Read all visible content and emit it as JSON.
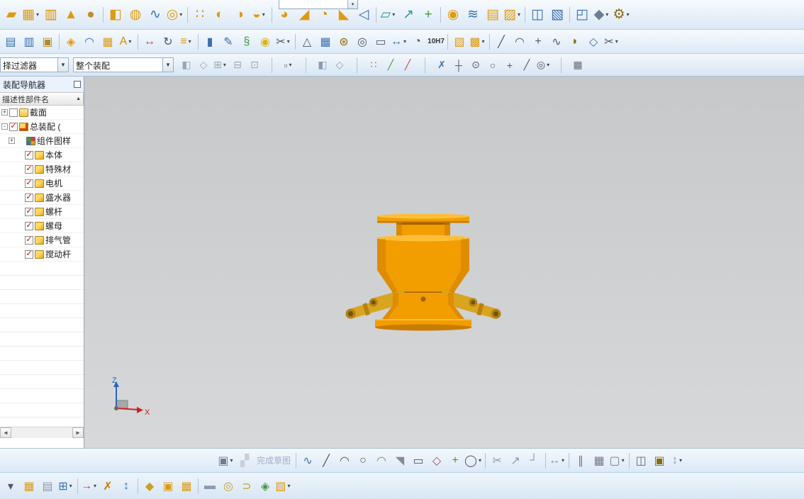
{
  "colors": {
    "model_main": "#f29d00",
    "model_light": "#ffbe3a",
    "model_dark": "#c97c00",
    "model_darker": "#a06200",
    "pipe": "#d9a41f",
    "pipe_dark": "#b5830f",
    "pipe_darkest": "#6e530a",
    "axis_x": "#cc2222",
    "axis_z": "#2b62c4",
    "viewport_top": "#c6c8ca",
    "viewport_bottom": "#d6d8da",
    "check_red": "#cc0000"
  },
  "filter_bar": {
    "selection_filter": "择过滤器",
    "scope": "整个装配"
  },
  "navigator": {
    "title": "装配导航器",
    "column_header": "描述性部件名",
    "sort_indicator": "▲",
    "rows": [
      {
        "exp": "+",
        "chk": "off",
        "ic": "node-icon ic-folder",
        "label": "截面",
        "pad": "padding-left:2px"
      },
      {
        "exp": "-",
        "chk": "on",
        "ic": "node-icon ic-assembly",
        "label": "总装配 (",
        "pad": "padding-left:2px"
      },
      {
        "exp": "+",
        "chk": "none",
        "ic": "node-icon ic-pattern",
        "label": "组件图样",
        "pad": "padding-left:12px"
      },
      {
        "exp": "",
        "chk": "on",
        "ic": "node-icon ic-part",
        "label": "本体",
        "pad": "padding-left:24px"
      },
      {
        "exp": "",
        "chk": "on",
        "ic": "node-icon ic-part",
        "label": "特殊材",
        "pad": "padding-left:24px"
      },
      {
        "exp": "",
        "chk": "on",
        "ic": "node-icon ic-part",
        "label": "电机",
        "pad": "padding-left:24px"
      },
      {
        "exp": "",
        "chk": "on",
        "ic": "node-icon ic-part",
        "label": "盛水器",
        "pad": "padding-left:24px"
      },
      {
        "exp": "",
        "chk": "on",
        "ic": "node-icon ic-part",
        "label": "螺杆",
        "pad": "padding-left:24px"
      },
      {
        "exp": "",
        "chk": "on",
        "ic": "node-icon ic-part",
        "label": "螺母",
        "pad": "padding-left:24px"
      },
      {
        "exp": "",
        "chk": "on",
        "ic": "node-icon ic-part",
        "label": "排气管",
        "pad": "padding-left:24px"
      },
      {
        "exp": "",
        "chk": "on",
        "ic": "node-icon ic-part",
        "label": "搅动杆",
        "pad": "padding-left:24px"
      }
    ],
    "empty_rows": [
      {},
      {},
      {},
      {},
      {},
      {},
      {},
      {},
      {},
      {},
      {}
    ],
    "scroll": {
      "left": "◄",
      "right": "►"
    }
  },
  "viewport": {
    "axis_x": "X",
    "axis_z": "Z"
  },
  "toolbars": {
    "row1": [
      {
        "n": "new-part-icon",
        "g": "▰",
        "style": "color:#e09a10"
      },
      {
        "n": "block-icon",
        "g": "▦",
        "style": "color:#e09a10",
        "t": "dd"
      },
      {
        "n": "cylinder-icon",
        "g": "▥",
        "style": "color:#d88f00"
      },
      {
        "n": "cone-icon",
        "g": "▲",
        "style": "color:#e09a10"
      },
      {
        "n": "sphere-icon",
        "g": "●",
        "style": "color:#c98a2a"
      },
      {
        "t": "sep",
        "ia": "false"
      },
      {
        "n": "extrude-icon",
        "g": "◧",
        "style": "color:#e09a10"
      },
      {
        "n": "revolve-icon",
        "g": "◍",
        "style": "color:#e09a10"
      },
      {
        "n": "sweep-icon",
        "g": "∿",
        "style": "color:#3a6fb0"
      },
      {
        "n": "tube-icon",
        "g": "◎",
        "style": "color:#e09a10",
        "t": "dd"
      },
      {
        "t": "sep",
        "ia": "false"
      },
      {
        "n": "pattern-feature-icon",
        "g": "∷",
        "style": "color:#d88f00"
      },
      {
        "n": "unite-icon",
        "g": "◐",
        "style": "color:#e09a10"
      },
      {
        "n": "subtract-icon",
        "g": "◑",
        "style": "color:#e09a10"
      },
      {
        "n": "intersect-icon",
        "g": "◒",
        "style": "color:#e09a10",
        "t": "dd"
      },
      {
        "t": "sep",
        "ia": "false"
      },
      {
        "n": "edge-blend-icon",
        "g": "◕",
        "style": "color:#e09a10"
      },
      {
        "n": "chamfer-icon",
        "g": "◢",
        "style": "color:#e09a10"
      },
      {
        "n": "shell-icon",
        "g": "◔",
        "style": "color:#d88f00"
      },
      {
        "n": "draft-icon",
        "g": "◣",
        "style": "color:#e09a10"
      },
      {
        "n": "trim-body-icon",
        "g": "◁",
        "style": "color:#3a6fb0"
      },
      {
        "t": "sep",
        "ia": "false"
      },
      {
        "n": "datum-plane-icon",
        "g": "▱",
        "style": "color:#2e9b9b",
        "t": "dd"
      },
      {
        "n": "datum-axis-icon",
        "g": "↗",
        "style": "color:#2e9b9b"
      },
      {
        "n": "datum-csys-icon",
        "g": "+",
        "style": "color:#3f9b3f"
      },
      {
        "t": "sep",
        "ia": "false"
      },
      {
        "n": "hole-icon",
        "g": "◉",
        "style": "color:#e09a10"
      },
      {
        "n": "thread-icon",
        "g": "≋",
        "style": "color:#3a6fb0"
      },
      {
        "n": "rib-icon",
        "g": "▤",
        "style": "color:#e09a10"
      },
      {
        "n": "emboss-icon",
        "g": "▨",
        "style": "color:#e09a10",
        "t": "dd"
      },
      {
        "t": "sep",
        "ia": "false"
      },
      {
        "n": "mirror-feature-icon",
        "g": "◫",
        "style": "color:#3a6fb0"
      },
      {
        "n": "sheet-body-icon",
        "g": "▧",
        "style": "color:#3a6fb0"
      },
      {
        "t": "sep",
        "ia": "false"
      },
      {
        "n": "section-view-icon",
        "g": "◰",
        "style": "color:#3a6fb0"
      },
      {
        "n": "render-style-icon",
        "g": "◆",
        "style": "color:#6b7f93",
        "t": "dd"
      },
      {
        "n": "customize-icon",
        "g": "⚙",
        "style": "color:#8a6a10",
        "t": "dd"
      }
    ],
    "row2": [
      {
        "n": "layer-settings-icon",
        "g": "▤",
        "style": "color:#3a6fb0"
      },
      {
        "n": "layer-category-icon",
        "g": "▥",
        "style": "color:#3a6fb0"
      },
      {
        "n": "clipboard-icon",
        "g": "▣",
        "style": "color:#b58a2a"
      },
      {
        "t": "sep",
        "ia": "false"
      },
      {
        "n": "transform-icon",
        "g": "◈",
        "style": "color:#e09a10"
      },
      {
        "n": "wave-link-icon",
        "g": "◠",
        "style": "color:#3a6fb0"
      },
      {
        "n": "pattern-geometry-icon",
        "g": "▦",
        "style": "color:#e09a10"
      },
      {
        "n": "text-tool-icon",
        "g": "A",
        "style": "color:#d88f00",
        "t": "dd"
      },
      {
        "t": "sep",
        "ia": "false"
      },
      {
        "n": "move-object-icon",
        "g": "↔",
        "style": "color:#b04a4a"
      },
      {
        "n": "rotate-object-icon",
        "g": "↻",
        "style": "color:#556"
      },
      {
        "n": "align-icon",
        "g": "≡",
        "style": "color:#e09a10",
        "t": "dd"
      },
      {
        "t": "sep",
        "ia": "false"
      },
      {
        "n": "expression-icon",
        "g": "▮",
        "style": "color:#3a6fb0"
      },
      {
        "n": "annotate-icon",
        "g": "✎",
        "style": "color:#3a6fb0"
      },
      {
        "n": "spring-tool-icon",
        "g": "§",
        "style": "color:#3f9b3f"
      },
      {
        "n": "washer-icon",
        "g": "◉",
        "style": "color:#d9b419"
      },
      {
        "n": "trim-curve-icon",
        "g": "✂",
        "style": "color:#556",
        "t": "dd"
      },
      {
        "t": "sep",
        "ia": "false"
      },
      {
        "n": "triangle-mesh-icon",
        "g": "△",
        "style": "color:#556"
      },
      {
        "n": "sheet-grid-icon",
        "g": "▦",
        "style": "color:#3a6fb0"
      },
      {
        "n": "gear-pair-icon",
        "g": "⊛",
        "style": "color:#8a6a10"
      },
      {
        "n": "bearing-icon",
        "g": "◎",
        "style": "color:#556"
      },
      {
        "n": "note-icon",
        "g": "▭",
        "style": "color:#556"
      },
      {
        "n": "dimension-icon",
        "g": "↔",
        "style": "color:#3a6fb0",
        "t": "dd"
      },
      {
        "n": "binocular-icon",
        "g": "◔",
        "style": "color:#556"
      },
      {
        "n": "tolerance-label",
        "g": "10H7",
        "t": "text",
        "style": "color:#333"
      },
      {
        "t": "sep",
        "ia": "false"
      },
      {
        "n": "arrangement-icon",
        "g": "▧",
        "style": "color:#e09a10"
      },
      {
        "n": "exploded-view-icon",
        "g": "▩",
        "style": "color:#e09a10",
        "t": "dd"
      },
      {
        "t": "sep",
        "ia": "false"
      },
      {
        "n": "line-curve-icon",
        "g": "╱",
        "style": "color:#556"
      },
      {
        "n": "arc-curve-icon",
        "g": "◠",
        "style": "color:#556"
      },
      {
        "n": "point-tool-icon",
        "g": "+",
        "style": "color:#556"
      },
      {
        "n": "studio-spline-icon",
        "g": "∿",
        "style": "color:#556"
      },
      {
        "n": "surface-icon",
        "g": "◗",
        "style": "color:#8a6a10"
      },
      {
        "n": "sew-icon",
        "g": "◇",
        "style": "color:#3a6fb0"
      },
      {
        "n": "section-curve-icon",
        "g": "✂",
        "style": "color:#556",
        "t": "dd"
      }
    ],
    "row3": [
      {
        "n": "show-hide-icon",
        "g": "◧",
        "style": "color:#9aa7b5"
      },
      {
        "n": "immediate-hide-icon",
        "g": "◇",
        "style": "color:#9aa7b5"
      },
      {
        "n": "move-to-layer-icon",
        "g": "⊞",
        "style": "color:#9aa7b5",
        "t": "dd"
      },
      {
        "n": "copy-to-layer-icon",
        "g": "⊟",
        "style": "color:#9aa7b5"
      },
      {
        "n": "layer-in-view-icon",
        "g": "⊡",
        "style": "color:#9aa7b5"
      },
      {
        "t": "sep",
        "ia": "false"
      },
      {
        "n": "rectangle-select-icon",
        "g": "▫",
        "style": "color:#667",
        "t": "dd"
      },
      {
        "t": "sep",
        "ia": "false"
      },
      {
        "n": "shaded-view-icon",
        "g": "◧",
        "style": "color:#8a9bb0"
      },
      {
        "n": "wireframe-view-icon",
        "g": "◇",
        "style": "color:#8a9bb0"
      },
      {
        "t": "sep",
        "ia": "false"
      },
      {
        "n": "snap-point-set-icon",
        "g": "∷",
        "style": "color:#cc7a00"
      },
      {
        "n": "snap-endpoint-icon",
        "g": "╱",
        "style": "color:#3f9b3f"
      },
      {
        "n": "snap-midpoint-icon",
        "g": "╱",
        "style": "color:#cc4444"
      },
      {
        "t": "sep",
        "ia": "false"
      },
      {
        "n": "snap-knot-icon",
        "g": "✗",
        "style": "color:#3a6fb0"
      },
      {
        "n": "snap-perpendicular-icon",
        "g": "┼",
        "style": "color:#556"
      },
      {
        "n": "snap-arc-center-icon",
        "g": "⊙",
        "style": "color:#556"
      },
      {
        "n": "snap-circle-icon",
        "g": "○",
        "style": "color:#556"
      },
      {
        "n": "snap-plus-icon",
        "g": "+",
        "style": "color:#556"
      },
      {
        "n": "snap-face-icon",
        "g": "╱",
        "style": "color:#556"
      },
      {
        "n": "snap-tangent-icon",
        "g": "◎",
        "style": "color:#556",
        "t": "dd"
      },
      {
        "t": "sep",
        "ia": "false"
      },
      {
        "n": "grid-toggle-icon",
        "g": "▦",
        "style": "color:#667"
      }
    ],
    "bottomA": [
      {
        "n": "sketch-task-icon",
        "g": "▣",
        "style": "color:#6b7f93",
        "t": "dd"
      },
      {
        "n": "finish-sketch-flag-icon",
        "g": "▞",
        "style": "color:#c9cfd6"
      },
      {
        "n": "finish-sketch-label",
        "g": "完成草图",
        "t": "label"
      },
      {
        "t": "sep",
        "ia": "false"
      },
      {
        "n": "profile-icon",
        "g": "∿",
        "style": "color:#3a6fb0"
      },
      {
        "n": "line-sketch-icon",
        "g": "╱",
        "style": "color:#556"
      },
      {
        "n": "arc-sketch-icon",
        "g": "◠",
        "style": "color:#556"
      },
      {
        "n": "circle-sketch-icon",
        "g": "○",
        "style": "color:#556"
      },
      {
        "n": "fillet-sketch-icon",
        "g": "◠",
        "style": "color:#889"
      },
      {
        "n": "chamfer-sketch-icon",
        "g": "◥",
        "style": "color:#889"
      },
      {
        "n": "rectangle-sketch-icon",
        "g": "▭",
        "style": "color:#556"
      },
      {
        "n": "polygon-sketch-icon",
        "g": "◇",
        "style": "color:#b04a4a"
      },
      {
        "n": "point-sketch-icon",
        "g": "+",
        "style": "color:#3f9b3f"
      },
      {
        "n": "ellipse-sketch-icon",
        "g": "◯",
        "style": "color:#556",
        "t": "dd"
      },
      {
        "t": "sep",
        "ia": "false"
      },
      {
        "n": "quick-trim-icon",
        "g": "✂",
        "style": "color:#8a9bb0"
      },
      {
        "n": "quick-extend-icon",
        "g": "↗",
        "style": "color:#8a9bb0"
      },
      {
        "n": "make-corner-icon",
        "g": "┘",
        "style": "color:#8a9bb0"
      },
      {
        "t": "sep",
        "ia": "false"
      },
      {
        "n": "rapid-dimension-icon",
        "g": "↔",
        "style": "color:#8a9bb0",
        "t": "dd"
      },
      {
        "t": "sep",
        "ia": "false"
      },
      {
        "n": "geometric-constraints-icon",
        "g": "∥",
        "style": "color:#778"
      },
      {
        "n": "pattern-curve-icon",
        "g": "▦",
        "style": "color:#778"
      },
      {
        "n": "offset-curve-icon",
        "g": "▢",
        "style": "color:#778",
        "t": "dd"
      },
      {
        "t": "sep",
        "ia": "false"
      },
      {
        "n": "mirror-curve-icon",
        "g": "◫",
        "style": "color:#667"
      },
      {
        "n": "project-curve-icon",
        "g": "▣",
        "style": "color:#8a6a10"
      },
      {
        "n": "reattach-icon",
        "g": "↕",
        "style": "color:#8a9bb0",
        "t": "dd"
      }
    ],
    "bottomB": [
      {
        "n": "overflow-caret-icon",
        "g": "▾",
        "style": "color:#556"
      },
      {
        "n": "assemblies-icon",
        "g": "▦",
        "style": "color:#e09a10"
      },
      {
        "n": "component-list-icon",
        "g": "▤",
        "style": "color:#8a9bb0"
      },
      {
        "n": "add-component-icon",
        "g": "⊞",
        "style": "color:#3a6fb0",
        "t": "dd"
      },
      {
        "t": "sep",
        "ia": "false"
      },
      {
        "n": "move-component-icon",
        "g": "→",
        "style": "color:#b04a4a",
        "t": "dd"
      },
      {
        "n": "assembly-constraints-icon",
        "g": "✗",
        "style": "color:#cc7a00"
      },
      {
        "n": "show-dof-icon",
        "g": "↕",
        "style": "color:#3a6fb0"
      },
      {
        "t": "sep",
        "ia": "false"
      },
      {
        "n": "wave-geometry-linker-icon",
        "g": "◆",
        "style": "color:#c8a028"
      },
      {
        "n": "pattern-component-icon",
        "g": "▣",
        "style": "color:#e09a10"
      },
      {
        "n": "mirror-assembly-icon",
        "g": "▦",
        "style": "color:#e09a10"
      },
      {
        "t": "sep",
        "ia": "false"
      },
      {
        "n": "sequence-icon",
        "g": "▬",
        "style": "color:#8a9bb0"
      },
      {
        "n": "ring-part-icon",
        "g": "◎",
        "style": "color:#c8a028"
      },
      {
        "n": "hook-part-icon",
        "g": "⊃",
        "style": "color:#c8a028"
      },
      {
        "n": "tag-part-icon",
        "g": "◈",
        "style": "color:#3f9b3f"
      },
      {
        "n": "exploded-component-icon",
        "g": "▧",
        "style": "color:#e09a10",
        "t": "dd"
      }
    ]
  }
}
